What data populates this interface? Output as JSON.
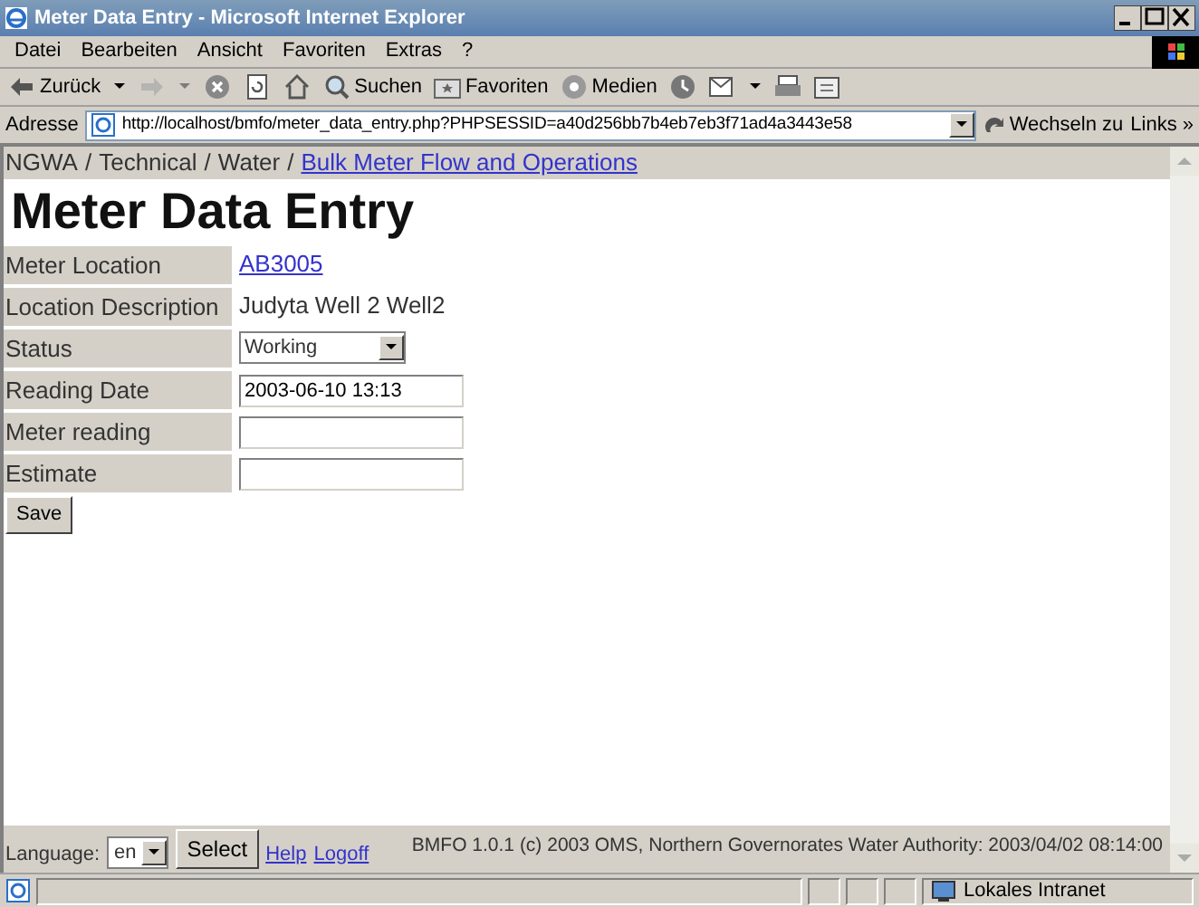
{
  "window": {
    "title": "Meter Data Entry - Microsoft Internet Explorer"
  },
  "menu_bar": [
    "Datei",
    "Bearbeiten",
    "Ansicht",
    "Favoriten",
    "Extras",
    "?"
  ],
  "toolbar": [
    {
      "label": "Zurück",
      "dropdown": true,
      "disabled": false
    },
    {
      "dropdown": true,
      "disabled": true
    },
    {
      "dropdown": false,
      "disabled": false
    },
    {
      "dropdown": false,
      "disabled": false
    },
    {
      "dropdown": false,
      "disabled": false
    },
    {
      "label": "Suchen",
      "dropdown": false,
      "disabled": false
    },
    {
      "label": "Favoriten",
      "dropdown": false,
      "disabled": false
    },
    {
      "label": "Medien",
      "dropdown": false,
      "disabled": false
    },
    {
      "dropdown": false,
      "disabled": false
    },
    {
      "dropdown": true,
      "disabled": false
    },
    {
      "dropdown": false,
      "disabled": false
    },
    {
      "dropdown": false,
      "disabled": false
    }
  ],
  "address_bar": {
    "label": "Adresse",
    "url": "http://localhost/bmfo/meter_data_entry.php?PHPSESSID=a40d256bb7b4eb7eb3f71ad4a3443e58",
    "go_button": "Wechseln zu",
    "links": "Links »"
  },
  "breadcrumb": [
    {
      "text": "NGWA",
      "link": false
    },
    {
      "text": "/",
      "link": false
    },
    {
      "text": "Technical",
      "link": false
    },
    {
      "text": "/",
      "link": false
    },
    {
      "text": "Water",
      "link": false
    },
    {
      "text": "/",
      "link": false
    },
    {
      "text": "Bulk Meter Flow and Operations",
      "link": true
    }
  ],
  "heading": "Meter Data Entry",
  "fields": [
    {
      "label": "Meter Location",
      "kind": "link",
      "value": "AB3005"
    },
    {
      "label": "Location Description",
      "kind": "text",
      "value": "Judyta Well 2 Well2"
    },
    {
      "label": "Status",
      "kind": "select",
      "value": "Working"
    },
    {
      "label": "Reading Date",
      "kind": "input",
      "value": "2003-06-10 13:13"
    },
    {
      "label": "Meter reading",
      "kind": "input"
    },
    {
      "label": "Estimate",
      "kind": "input"
    }
  ],
  "save_button": "Save",
  "footer": {
    "language_label": "Language:",
    "language": "en",
    "select_button": "Select",
    "links": [
      "Help",
      "Logoff"
    ],
    "copyright": "BMFO 1.0.1 (c) 2003 OMS, Northern Governorates Water Authority: 2003/04/02 08:14:00"
  },
  "status_bar": {
    "zone": "Lokales Intranet"
  }
}
